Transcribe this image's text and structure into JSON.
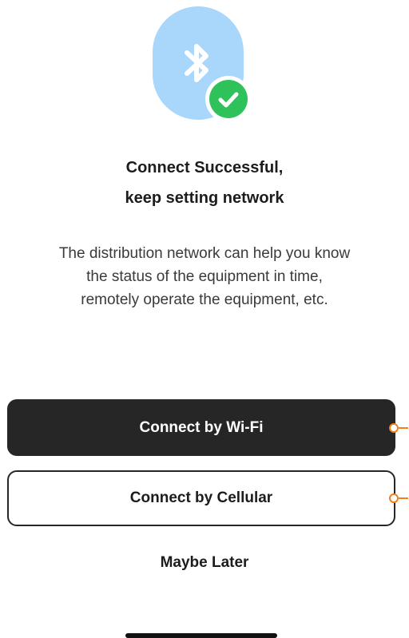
{
  "hero": {
    "bluetooth_icon": "bluetooth-icon",
    "status_icon": "check-circle-icon",
    "colors": {
      "pill": "#a9d6fb",
      "check": "#2fc25b"
    }
  },
  "title": {
    "line1": "Connect Successful,",
    "line2": "keep setting network"
  },
  "description": {
    "line1": "The distribution network can help you know",
    "line2": "the status of the equipment in time,",
    "line3": "remotely operate the equipment, etc."
  },
  "actions": {
    "wifi_label": "Connect by Wi-Fi",
    "cellular_label": "Connect by Cellular",
    "later_label": "Maybe Later"
  },
  "colors": {
    "primary_button": "#262626",
    "annotation_marker": "#f07f1f"
  }
}
